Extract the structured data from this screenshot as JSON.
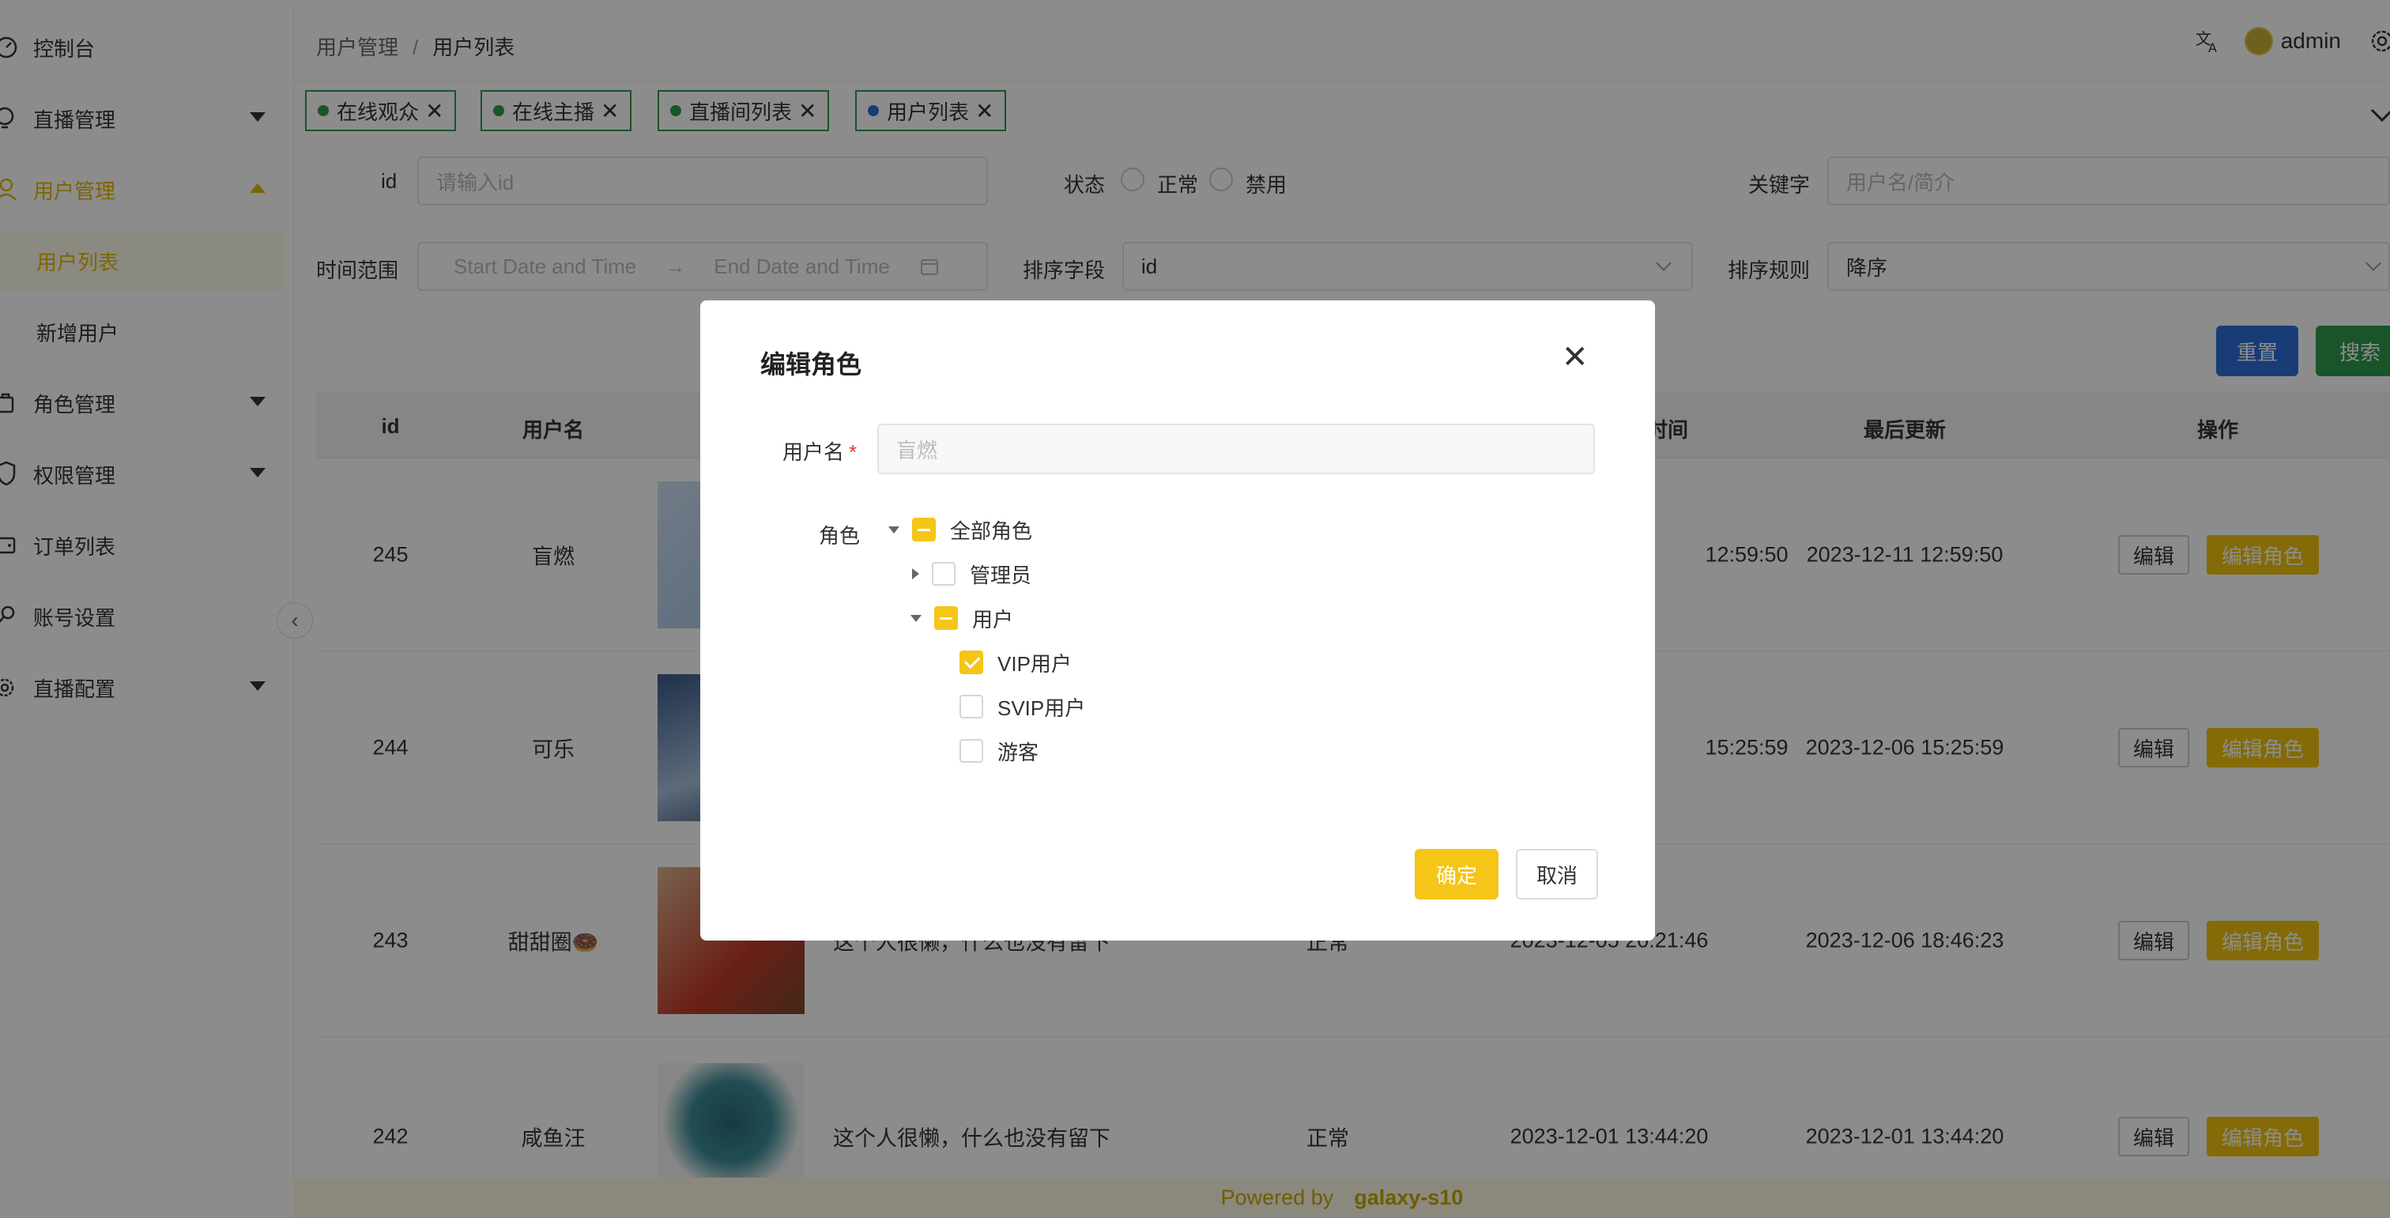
{
  "sidebar": {
    "items": [
      {
        "label": "控制台",
        "icon": "dashboard-icon"
      },
      {
        "label": "直播管理",
        "icon": "bulb-icon"
      },
      {
        "label": "用户管理",
        "icon": "user-icon"
      },
      {
        "label": "角色管理",
        "icon": "bag-icon"
      },
      {
        "label": "权限管理",
        "icon": "shield-icon"
      },
      {
        "label": "订单列表",
        "icon": "wallet-icon"
      },
      {
        "label": "账号设置",
        "icon": "key-icon"
      },
      {
        "label": "直播配置",
        "icon": "gear-icon"
      }
    ],
    "sub_items": [
      {
        "label": "用户列表"
      },
      {
        "label": "新增用户"
      }
    ]
  },
  "header": {
    "breadcrumb": [
      "用户管理",
      "用户列表"
    ],
    "breadcrumb_sep": "/",
    "username": "admin"
  },
  "tabs": [
    {
      "label": "在线观众"
    },
    {
      "label": "在线主播"
    },
    {
      "label": "直播间列表"
    },
    {
      "label": "用户列表"
    }
  ],
  "search": {
    "id_label": "id",
    "id_placeholder": "请输入id",
    "status_label": "状态",
    "status_options": [
      "正常",
      "禁用"
    ],
    "keyword_label": "关键字",
    "keyword_placeholder": "用户名/简介",
    "time_label": "时间范围",
    "start_placeholder": "Start Date and Time",
    "end_placeholder": "End Date and Time",
    "time_arrow": "→",
    "sort_field_label": "排序字段",
    "sort_field_value": "id",
    "sort_rule_label": "排序规则",
    "sort_rule_value": "降序",
    "reset_label": "重置",
    "search_label": "搜索"
  },
  "table": {
    "headers": {
      "id": "id",
      "username": "用户名",
      "updated": "最后更新",
      "actions": "操作",
      "created_partial": "时间"
    },
    "rows": [
      {
        "id": "245",
        "username": "盲燃",
        "bio": "",
        "status": "",
        "created": "12:59:50",
        "updated": "2023-12-11 12:59:50"
      },
      {
        "id": "244",
        "username": "可乐",
        "bio": "",
        "status": "",
        "created": "15:25:59",
        "updated": "2023-12-06 15:25:59"
      },
      {
        "id": "243",
        "username": "甜甜圈🍩",
        "bio": "这个人很懒，什么也没有留下",
        "status": "正常",
        "created": "2023-12-05 20:21:46",
        "updated": "2023-12-06 18:46:23"
      },
      {
        "id": "242",
        "username": "咸鱼汪",
        "bio": "这个人很懒，什么也没有留下",
        "status": "正常",
        "created": "2023-12-01 13:44:20",
        "updated": "2023-12-01 13:44:20"
      }
    ],
    "edit_label": "编辑",
    "edit_role_label": "编辑角色"
  },
  "footer": {
    "prefix": "Powered by",
    "name": "galaxy-s10"
  },
  "modal": {
    "title": "编辑角色",
    "username_label": "用户名",
    "required_mark": "*",
    "username_placeholder": "盲燃",
    "role_label": "角色",
    "tree": {
      "root": "全部角色",
      "admin": "管理员",
      "user": "用户",
      "vip": "VIP用户",
      "svip": "SVIP用户",
      "guest": "游客"
    },
    "ok_label": "确定",
    "cancel_label": "取消"
  },
  "colors": {
    "accent": "#f5c518",
    "primary": "#2f6ed8",
    "success": "#2e9a4e"
  }
}
